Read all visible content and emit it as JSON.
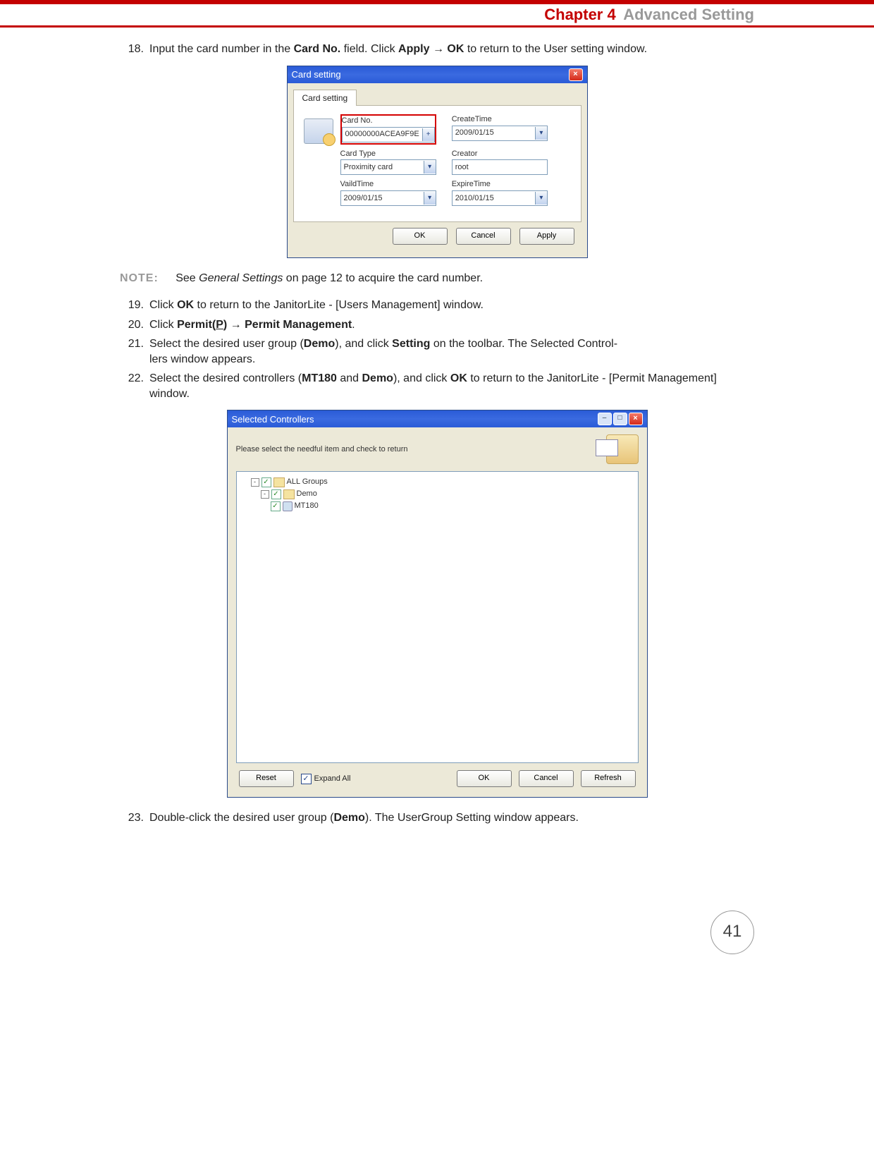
{
  "header": {
    "chapter": "Chapter 4",
    "section": "Advanced Setting"
  },
  "steps": {
    "s18": {
      "num": "18.",
      "t1": "Input the card number in the ",
      "b1": "Card No.",
      "t2": " field. Click ",
      "b2": "Apply",
      "arr": " → ",
      "b3": "OK",
      "t3": " to return to the User setting window."
    },
    "note": {
      "label": "NOTE:",
      "t1": "See ",
      "i1": "General Settings",
      "t2": " on page 12 to acquire the card number."
    },
    "s19": {
      "num": "19.",
      "t1": "Click ",
      "b1": "OK",
      "t2": " to return to the JanitorLite - [Users Management] window."
    },
    "s20": {
      "num": "20.",
      "t1": "Click ",
      "b1a": "Permit(",
      "b1u": "P",
      "b1b": ")",
      "arr": " → ",
      "b2": "Permit Management",
      "t2": "."
    },
    "s21": {
      "num": "21.",
      "t1": "Select the desired user group (",
      "b1": "Demo",
      "t2": "), and click ",
      "b2": "Setting",
      "t3": " on the toolbar. The Selected Control",
      "t4": "lers window appears."
    },
    "s22": {
      "num": "22.",
      "t1": "Select the desired controllers (",
      "b1": "MT180",
      "t2": " and ",
      "b2": "Demo",
      "t3": "), and click ",
      "b3": "OK",
      "t4": " to return to the JanitorLite - [Permit Management] window."
    },
    "s23": {
      "num": "23.",
      "t1": "Double-click the desired user group (",
      "b1": "Demo",
      "t2": "). The UserGroup Setting window appears."
    }
  },
  "dlg1": {
    "title": "Card setting",
    "tab": "Card setting",
    "labels": {
      "cardno": "Card No.",
      "createtime": "CreateTime",
      "cardtype": "Card Type",
      "creator": "Creator",
      "validtime": "VaildTime",
      "expiretime": "ExpireTime"
    },
    "values": {
      "cardno": "00000000ACEA9F9E",
      "createtime": "2009/01/15",
      "cardtype": "Proximity card",
      "creator": "root",
      "validtime": "2009/01/15",
      "expiretime": "2010/01/15"
    },
    "buttons": {
      "ok": "OK",
      "cancel": "Cancel",
      "apply": "Apply"
    }
  },
  "dlg2": {
    "title": "Selected Controllers",
    "hint": "Please select the needful item and check to return",
    "tree": {
      "root": "ALL Groups",
      "child": "Demo",
      "leaf": "MT180"
    },
    "footer": {
      "reset": "Reset",
      "expand": "Expand All",
      "ok": "OK",
      "cancel": "Cancel",
      "refresh": "Refresh"
    }
  },
  "pagenum": "41"
}
